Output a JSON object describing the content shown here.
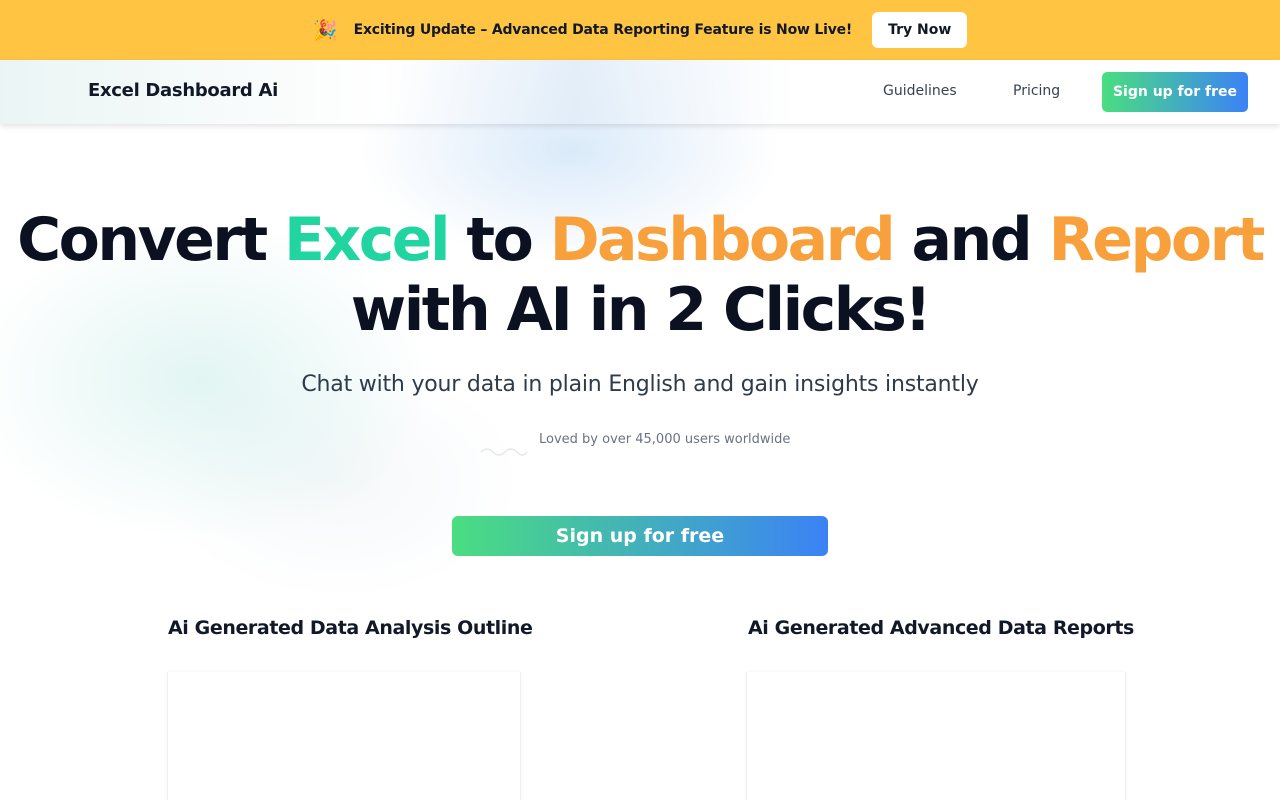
{
  "announcement": {
    "emoji": "🎉",
    "text": "Exciting Update – Advanced Data Reporting Feature is Now Live!",
    "button_label": "Try Now"
  },
  "nav": {
    "brand": "Excel Dashboard Ai",
    "links": [
      "Guidelines",
      "Pricing"
    ],
    "signup_label": "Sign up for free"
  },
  "hero": {
    "title_parts": [
      "Convert ",
      "Excel",
      " to ",
      "Dashboard",
      " and ",
      "Report"
    ],
    "title_line2": "with AI in 2 Clicks!",
    "subtitle": "Chat with your data in plain English and gain insights instantly",
    "social_proof": "Loved by over 45,000 users worldwide",
    "cta_label": "Sign up for free"
  },
  "sections": [
    {
      "title": "Ai Generated Data Analysis Outline"
    },
    {
      "title": "Ai Generated Advanced Data Reports"
    }
  ],
  "colors": {
    "banner": "#ffc542",
    "excel_highlight": "#20d5a0",
    "orange_highlight": "#f7a03c",
    "gradient_start": "#4ade80",
    "gradient_end": "#3b82f6"
  }
}
